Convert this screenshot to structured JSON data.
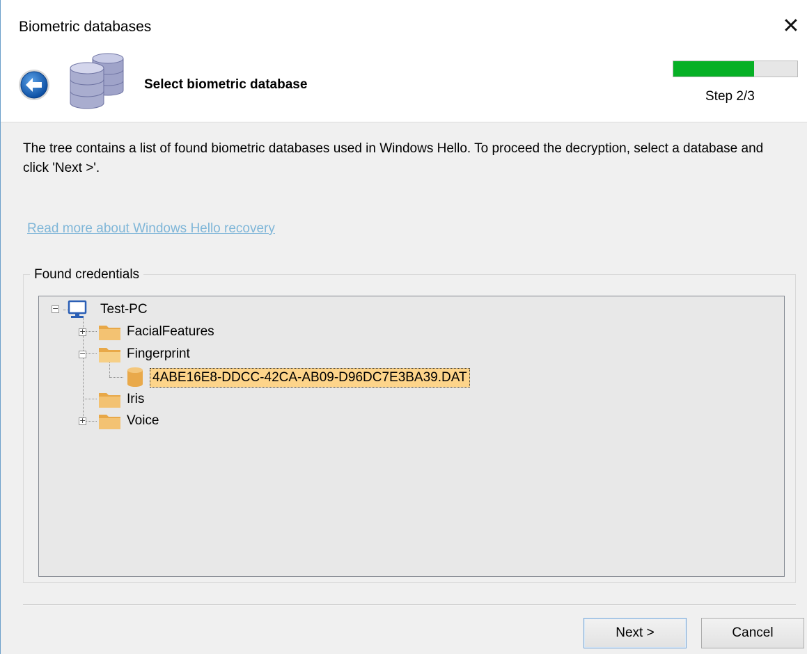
{
  "window": {
    "title": "Biometric databases",
    "close_glyph": "✕"
  },
  "header": {
    "back_icon": "back-arrow-icon",
    "database_icon": "database-stack-icon",
    "step_title": "Select biometric database",
    "progress_fraction": 0.65,
    "progress_color": "#06b025",
    "step_label": "Step 2/3"
  },
  "description": "The tree contains a list of found biometric databases used in Windows Hello. To proceed the decryption, select a database and click 'Next >'.",
  "link": "Read more about Windows Hello recovery",
  "group": {
    "label": "Found credentials"
  },
  "tree": {
    "root": {
      "label": "Test-PC",
      "icon": "computer-icon",
      "expanded": true
    },
    "folders": [
      {
        "label": "FacialFeatures",
        "icon": "folder-icon",
        "expander": "+"
      },
      {
        "label": "Fingerprint",
        "icon": "folder-icon",
        "expander": "−"
      },
      {
        "label": "Iris",
        "icon": "folder-icon",
        "expander": ""
      },
      {
        "label": "Voice",
        "icon": "folder-icon",
        "expander": "+"
      }
    ],
    "file": {
      "label": "4ABE16E8-DDCC-42CA-AB09-D96DC7E3BA39.DAT",
      "icon": "database-file-icon",
      "selected": true
    }
  },
  "buttons": {
    "next": "Next >",
    "cancel": "Cancel"
  }
}
